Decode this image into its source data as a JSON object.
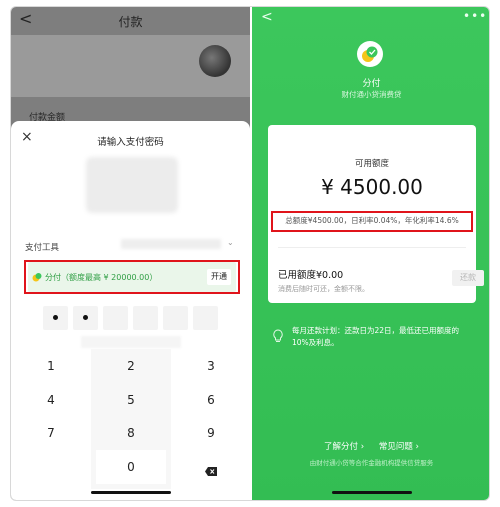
{
  "left": {
    "nav_back": "<",
    "nav_title": "付款",
    "pay_label": "付款金额",
    "sheet": {
      "close": "×",
      "title": "请输入支付密码",
      "tool_label": "支付工具",
      "method_text": "分付（额度最高 ¥ 20000.00）",
      "open_button": "开通"
    },
    "keys": [
      "1",
      "2",
      "3",
      "4",
      "5",
      "6",
      "7",
      "8",
      "9",
      "0"
    ],
    "pin_dots_filled": 2
  },
  "right": {
    "back": "<",
    "more": "•••",
    "brand": "分付",
    "brand_sub": "财付通小贷消费贷",
    "card": {
      "avail_label": "可用额度",
      "amount": "¥ 4500.00",
      "rate_line": "总额度¥4500.00，日利率0.04%，年化利率14.6%",
      "used": "已用额度¥0.00",
      "used_hint": "消费后随时可还，金额不限。",
      "repay_button": "还款"
    },
    "plan_text": "每月还款计划：还款日为22日，最低还已用额度的10%及利息。",
    "links": [
      "了解分付 ›",
      "常见问题 ›"
    ],
    "footer": "由财付通小贷等合作金融机构提供信贷服务"
  },
  "colors": {
    "green": "#3cc75c",
    "highlight_red": "#e0141b",
    "method_green": "#2f9e44"
  }
}
